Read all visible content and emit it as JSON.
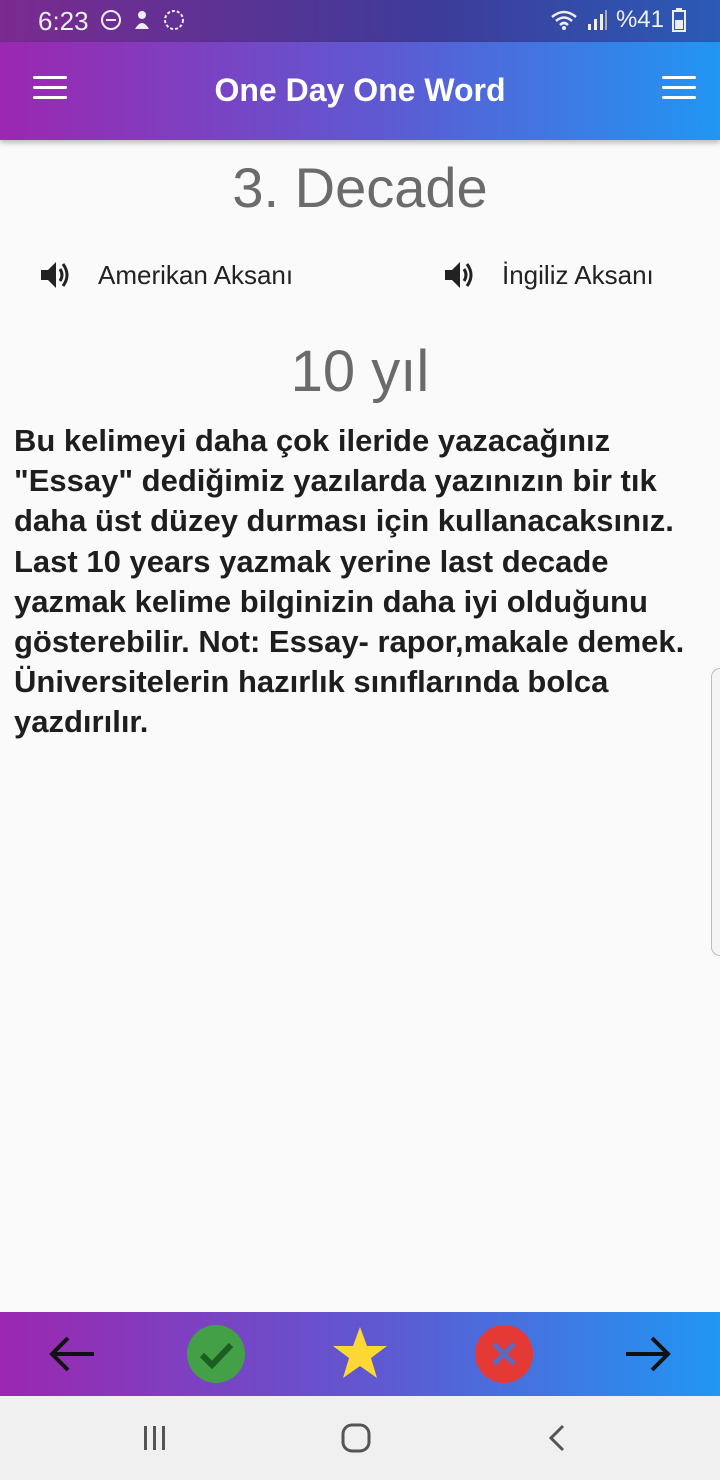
{
  "status_bar": {
    "time": "6:23",
    "battery": "%41",
    "icons_left": [
      "do-not-disturb-icon",
      "notification-icon",
      "sync-icon"
    ],
    "icons_right": [
      "wifi-icon",
      "signal-icon",
      "battery-icon"
    ]
  },
  "app_bar": {
    "title": "One Day One Word",
    "left_icon": "menu-icon",
    "right_icon": "menu-icon"
  },
  "word": {
    "title": "3. Decade",
    "accents": [
      {
        "label": "Amerikan Aksanı",
        "icon": "speaker-icon"
      },
      {
        "label": "İngiliz Aksanı",
        "icon": "speaker-icon"
      }
    ],
    "meaning": "10 yıl",
    "description": "Bu kelimeyi daha çok ileride yazacağınız \"Essay\" dediğimiz yazılarda yazınızın bir tık daha üst düzey durması için kullanacaksınız. Last 10 years yazmak yerine last decade yazmak kelime bilginizin daha iyi olduğunu gösterebilir. Not: Essay- rapor,makale demek. Üniversitelerin hazırlık sınıflarında bolca yazdırılır."
  },
  "bottom_bar": {
    "buttons": [
      "arrow-left-icon",
      "check-circle-icon",
      "star-icon",
      "close-circle-icon",
      "arrow-right-icon"
    ],
    "colors": {
      "check": "#43a047",
      "star": "#fdd835",
      "close": "#e53935"
    }
  },
  "system_nav": {
    "buttons": [
      "recent-apps-icon",
      "home-icon",
      "back-icon"
    ]
  },
  "theme": {
    "gradient_start": "#9c27b0",
    "gradient_end": "#2196f3",
    "background": "#fafafa"
  }
}
